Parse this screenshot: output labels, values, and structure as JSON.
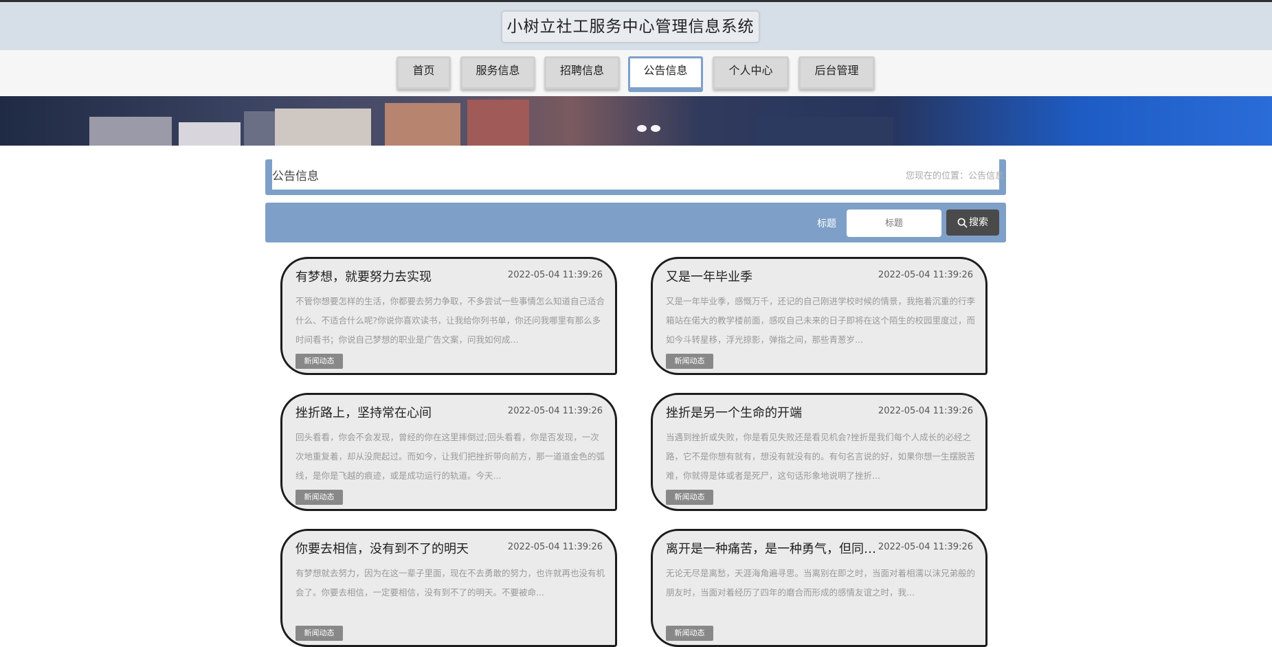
{
  "header": {
    "title": "小树立社工服务中心管理信息系统"
  },
  "nav": {
    "items": [
      {
        "label": "首页"
      },
      {
        "label": "服务信息"
      },
      {
        "label": "招聘信息"
      },
      {
        "label": "公告信息",
        "active": true
      },
      {
        "label": "个人中心"
      },
      {
        "label": "后台管理"
      }
    ]
  },
  "breadcrumb": {
    "title": "公告信息",
    "path": "您现在的位置：公告信息"
  },
  "search": {
    "label": "标题",
    "placeholder": "标题",
    "button": "搜索"
  },
  "colors": {
    "accent": "#7ea0c8",
    "header_bg": "#d6dee8",
    "card_bg": "#ebebec"
  },
  "cards": [
    {
      "title": "有梦想，就要努力去实现",
      "date": "2022-05-04 11:39:26",
      "desc": "不管你想要怎样的生活，你都要去努力争取，不多尝试一些事情怎么知道自己适合什么、不适合什么呢?你说你喜欢读书，让我给你列书单，你还问我哪里有那么多时间看书；你说自己梦想的职业是广告文案，问我如何成...",
      "tag": "新闻动态"
    },
    {
      "title": "又是一年毕业季",
      "date": "2022-05-04 11:39:26",
      "desc": "又是一年毕业季，感慨万千，还记的自己刚进学校时候的情景，我拖着沉重的行李箱站在偌大的教学楼前面，感叹自己未来的日子即将在这个陌生的校园里度过，而如今斗转星移，浮光掠影，弹指之间，那些青葱岁...",
      "tag": "新闻动态"
    },
    {
      "title": "挫折路上，坚持常在心间",
      "date": "2022-05-04 11:39:26",
      "desc": "回头看看，你会不会发现，曾经的你在这里摔倒过;回头看看，你是否发现，一次次地重复着，却从没爬起过。而如今，让我们把挫折带向前方，那一道道金色的弧线，是你是飞越的痕迹，或是成功运行的轨道。今天...",
      "tag": "新闻动态"
    },
    {
      "title": "挫折是另一个生命的开端",
      "date": "2022-05-04 11:39:26",
      "desc": "当遇到挫折或失败，你是看见失败还是看见机会?挫折是我们每个人成长的必经之路，它不是你想有就有，想没有就没有的。有句名言说的好，如果你想一生摆脱苦难，你就得是体或者是死尸，这句话形象地说明了挫折...",
      "tag": "新闻动态"
    },
    {
      "title": "你要去相信，没有到不了的明天",
      "date": "2022-05-04 11:39:26",
      "desc": "有梦想就去努力，因为在这一辈子里面，现在不去勇敢的努力，也许就再也没有机会了。你要去相信，一定要相信，没有到不了的明天。不要被命...",
      "tag": "新闻动态"
    },
    {
      "title": "离开是一种痛苦，是一种勇气，但同样也是一个考验",
      "date": "2022-05-04 11:39:26",
      "desc": "无论无尽是离愁，天涯海角遍寻思。当离别在即之时，当面对着相濡以沫兄弟般的朋友时，当面对着经历了四年的磨合而形成的感情友谊之时，我...",
      "tag": "新闻动态"
    }
  ]
}
